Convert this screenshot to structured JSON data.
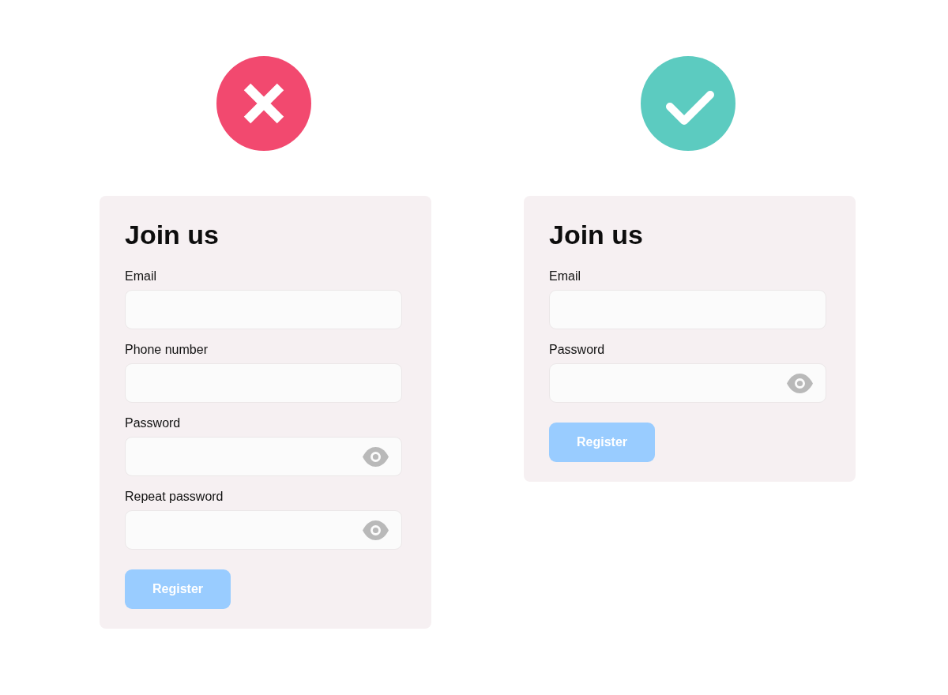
{
  "examples": [
    {
      "verdict": {
        "kind": "wrong",
        "color": "#f2496f"
      },
      "form": {
        "title": "Join us",
        "fields": [
          {
            "label": "Email",
            "kind": "text"
          },
          {
            "label": "Phone number",
            "kind": "text"
          },
          {
            "label": "Password",
            "kind": "password"
          },
          {
            "label": "Repeat password",
            "kind": "password"
          }
        ],
        "button": {
          "label": "Register",
          "disabled": true
        }
      }
    },
    {
      "verdict": {
        "kind": "right",
        "color": "#5ccbc0"
      },
      "form": {
        "title": "Join us",
        "fields": [
          {
            "label": "Email",
            "kind": "text"
          },
          {
            "label": "Password",
            "kind": "password"
          }
        ],
        "button": {
          "label": "Register",
          "disabled": true
        }
      }
    }
  ]
}
